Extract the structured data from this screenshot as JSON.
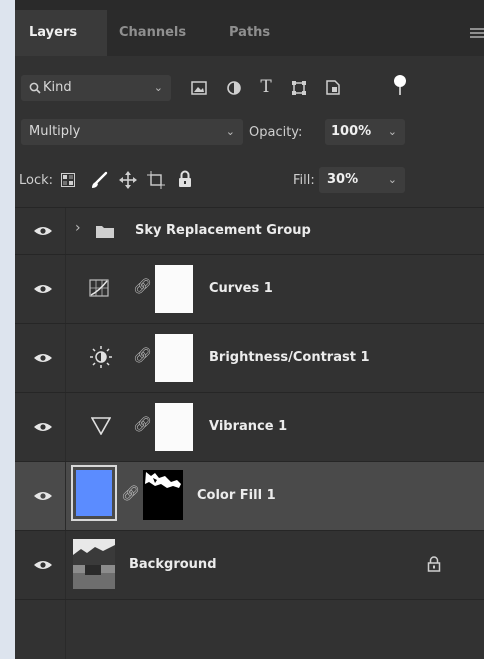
{
  "tabs": {
    "layers": "Layers",
    "channels": "Channels",
    "paths": "Paths"
  },
  "filter": {
    "kind_label": "Kind"
  },
  "blend": {
    "mode": "Multiply",
    "opacity_label": "Opacity:",
    "opacity_value": "100%"
  },
  "lock": {
    "label": "Lock:",
    "fill_label": "Fill:",
    "fill_value": "30%"
  },
  "layers": [
    {
      "name": "Sky Replacement Group"
    },
    {
      "name": "Curves 1"
    },
    {
      "name": "Brightness/Contrast 1"
    },
    {
      "name": "Vibrance 1"
    },
    {
      "name": "Color Fill 1"
    },
    {
      "name": "Background"
    }
  ],
  "colors": {
    "panel": "#323232",
    "fill_swatch": "#5b8cff",
    "selected_row": "#4a4a4a"
  }
}
